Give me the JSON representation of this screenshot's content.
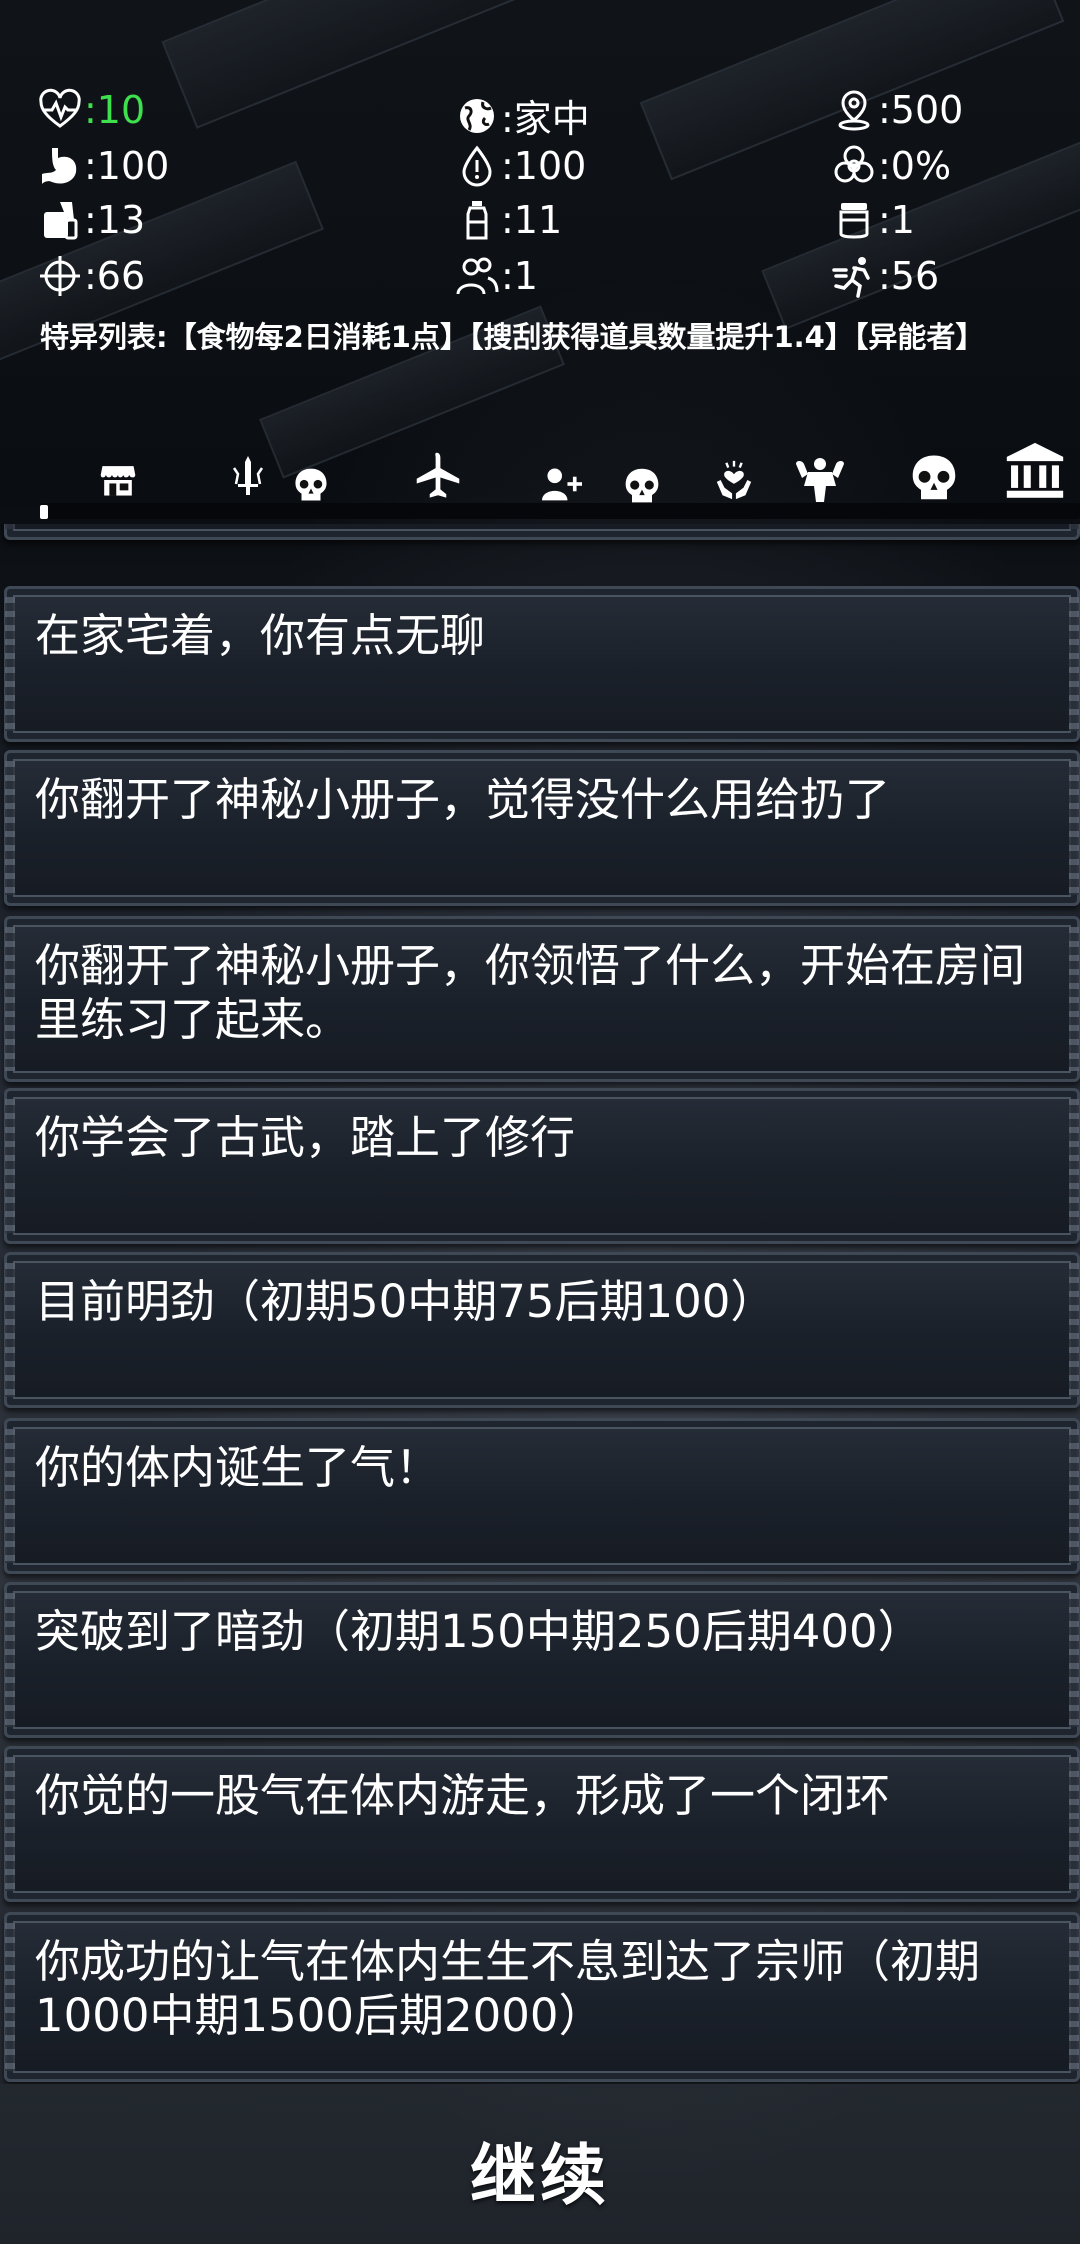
{
  "stats": {
    "health": {
      "icon": "heartbeat-icon",
      "value": ":10"
    },
    "location": {
      "icon": "globe-icon",
      "value": ":家中"
    },
    "money": {
      "icon": "location-pin-icon",
      "value": ":500"
    },
    "hunger": {
      "icon": "stomach-icon",
      "value": ":100"
    },
    "thirst": {
      "icon": "water-drop-icon",
      "value": ":100"
    },
    "infection": {
      "icon": "biohazard-icon",
      "value": ":0%"
    },
    "food": {
      "icon": "food-can-icon",
      "value": ":13"
    },
    "water": {
      "icon": "water-bottle-icon",
      "value": ":11"
    },
    "supplies": {
      "icon": "jar-icon",
      "value": ":1"
    },
    "attack": {
      "icon": "crosshair-icon",
      "value": ":66"
    },
    "companions": {
      "icon": "people-icon",
      "value": ":1"
    },
    "speed": {
      "icon": "running-man-icon",
      "value": ":56"
    }
  },
  "traits": "特异列表:【食物每2日消耗1点】【搜刮获得道具数量提升1.4】【异能者】",
  "toolbar": {
    "icons": [
      "store-icon",
      "sword-icon",
      "skull-icon",
      "airplane-icon",
      "add-person-icon",
      "skull-icon",
      "heal-hands-icon",
      "muscle-icon",
      "skull-icon",
      "bank-icon"
    ],
    "progress": 0.0
  },
  "log": [
    "在家宅着，你有点无聊",
    "你翻开了神秘小册子，觉得没什么用给扔了",
    "你翻开了神秘小册子，你领悟了什么，开始在房间里练习了起来。",
    "你学会了古武，踏上了修行",
    "目前明劲（初期50中期75后期100）",
    "你的体内诞生了气！",
    "突破到了暗劲（初期150中期250后期400）",
    "你觉的一股气在体内游走，形成了一个闭环",
    "你成功的让气在体内生生不息到达了宗师（初期1000中期1500后期2000）"
  ],
  "continue_label": "继续",
  "colors": {
    "health_value": "#3ee04e",
    "text": "#ffffff",
    "card_border": "#3f4855"
  }
}
